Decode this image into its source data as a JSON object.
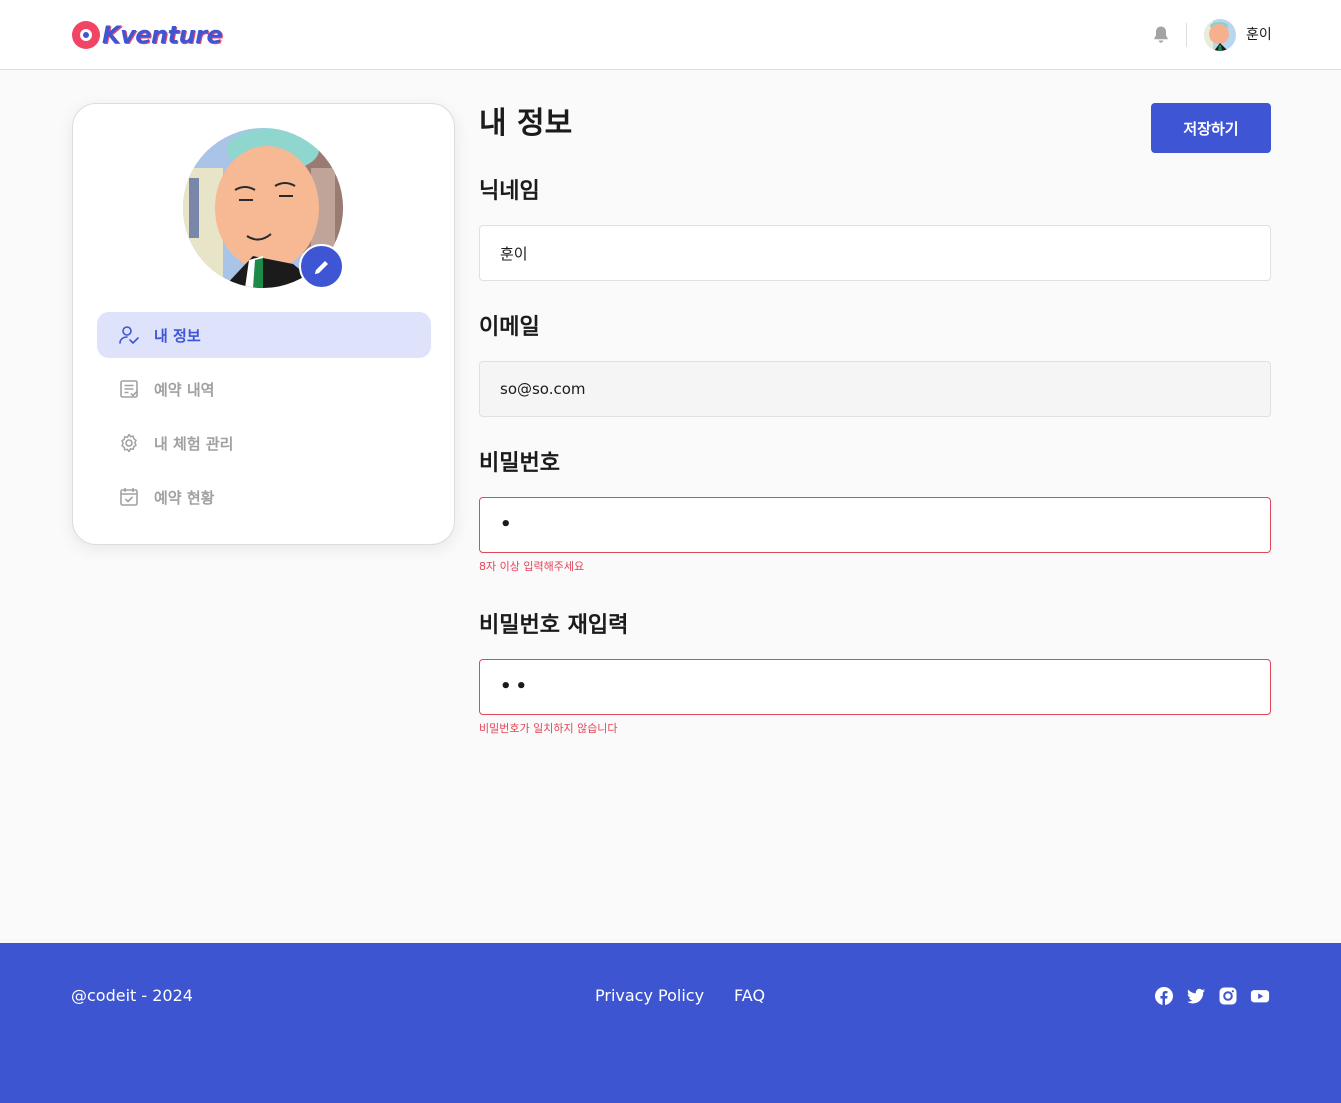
{
  "header": {
    "logo_text": "Kventure",
    "nickname": "훈이"
  },
  "sidebar": {
    "items": [
      {
        "label": "내 정보",
        "icon": "user-check-icon",
        "active": true
      },
      {
        "label": "예약 내역",
        "icon": "list-check-icon",
        "active": false
      },
      {
        "label": "내 체험 관리",
        "icon": "gear-icon",
        "active": false
      },
      {
        "label": "예약 현황",
        "icon": "calendar-check-icon",
        "active": false
      }
    ]
  },
  "main": {
    "title": "내 정보",
    "save_label": "저장하기",
    "nickname": {
      "label": "닉네임",
      "value": "훈이"
    },
    "email": {
      "label": "이메일",
      "value": "so@so.com"
    },
    "password": {
      "label": "비밀번호",
      "value": "•",
      "error": "8자 이상 입력해주세요"
    },
    "password_confirm": {
      "label": "비밀번호 재입력",
      "value": "••",
      "error": "비밀번호가 일치하지 않습니다"
    }
  },
  "footer": {
    "copyright": "@codeit - 2024",
    "links": [
      "Privacy Policy",
      "FAQ"
    ],
    "socials": [
      "facebook-icon",
      "twitter-icon",
      "instagram-icon",
      "youtube-icon"
    ]
  },
  "colors": {
    "primary": "#3e55d4",
    "footer_bg": "#3d55d1",
    "error": "#e2465a",
    "active_menu_bg": "#dee2fb",
    "logo_accent": "#f24464"
  }
}
